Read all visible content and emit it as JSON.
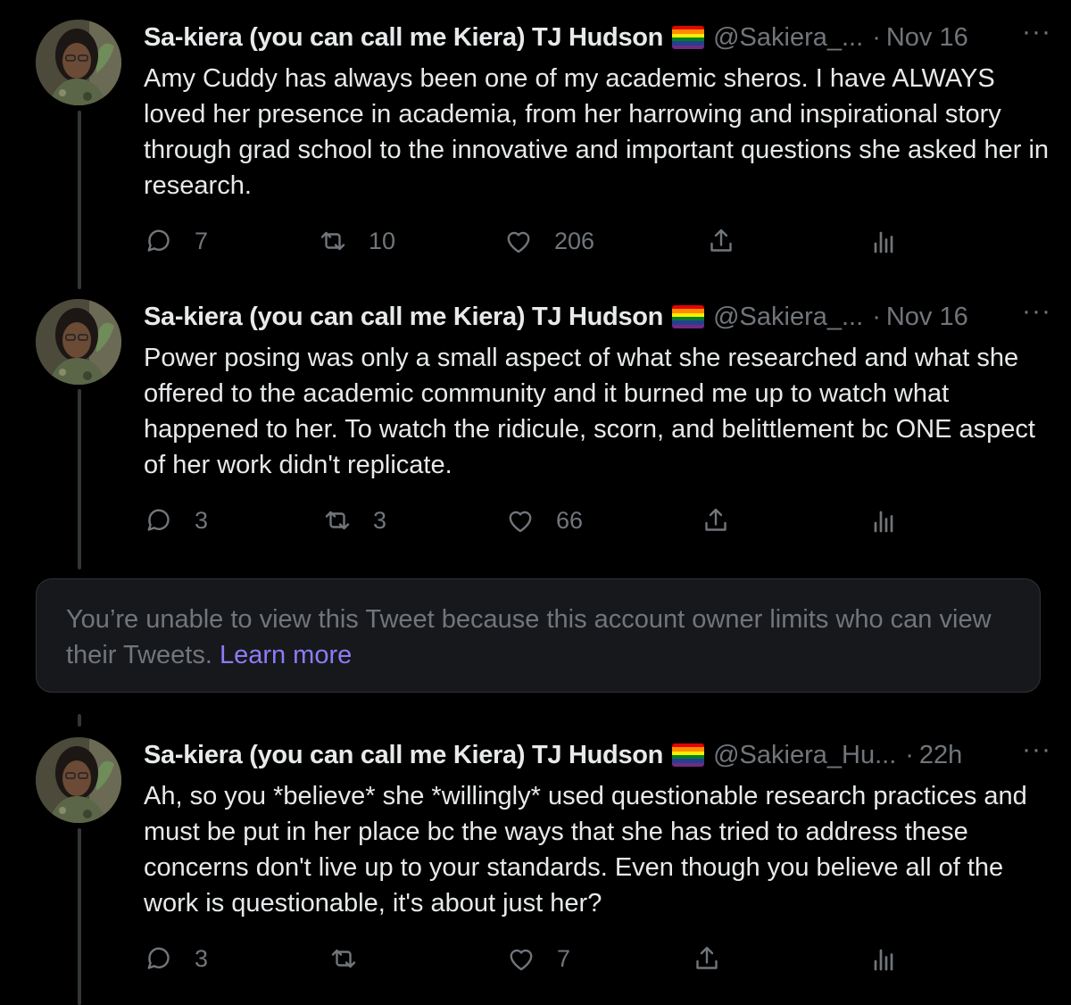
{
  "colors": {
    "background": "#000000",
    "text_primary": "#e7e9ea",
    "text_secondary": "#71767b",
    "link": "#8b7cf6",
    "thread_line": "#333639"
  },
  "tweets": [
    {
      "name": "Sa-kiera (you can call me Kiera) TJ Hudson",
      "flag_icon": "rainbow-flag-icon",
      "handle": "@Sakiera_...",
      "separator": "·",
      "time": "Nov 16",
      "more": "···",
      "text": "Amy Cuddy has always been one of my academic sheros. I have ALWAYS loved her presence in academia, from her harrowing and inspirational story through grad school to the innovative and important questions she asked her in research.",
      "replies": "7",
      "retweets": "10",
      "likes": "206"
    },
    {
      "name": "Sa-kiera (you can call me Kiera) TJ Hudson",
      "flag_icon": "rainbow-flag-icon",
      "handle": "@Sakiera_...",
      "separator": "·",
      "time": "Nov 16",
      "more": "···",
      "text": "Power posing was only a small aspect of what she researched and what she offered to the academic community and it burned me up to watch what happened to her. To watch the ridicule, scorn, and belittlement bc ONE aspect of her work didn't replicate.",
      "replies": "3",
      "retweets": "3",
      "likes": "66"
    },
    {
      "name": "Sa-kiera (you can call me Kiera) TJ Hudson",
      "flag_icon": "rainbow-flag-icon",
      "handle": "@Sakiera_Hu...",
      "separator": "·",
      "time": "22h",
      "more": "···",
      "text": "Ah, so you *believe* she *willingly* used questionable research practices and must be put in her place bc the ways that she has tried to address these concerns don't live up to your standards. Even though you believe all of the work is questionable, it's about just her?",
      "replies": "3",
      "retweets": "",
      "likes": "7"
    }
  ],
  "notice": {
    "text": "You’re unable to view this Tweet because this account owner limits who can view their Tweets. ",
    "link": "Learn more"
  }
}
